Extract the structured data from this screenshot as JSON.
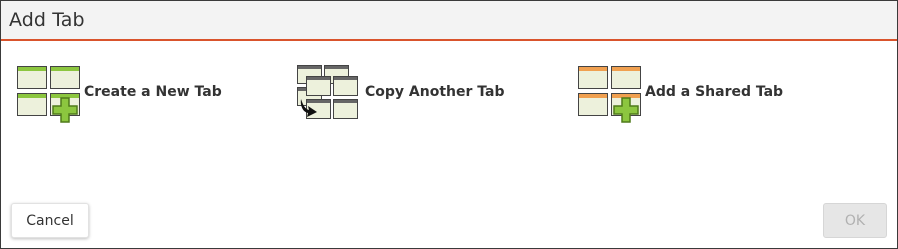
{
  "dialog": {
    "title": "Add Tab"
  },
  "options": [
    {
      "label": "Create a New Tab",
      "icon": "new-tab-icon",
      "accent": "#8cc63f"
    },
    {
      "label": "Copy Another Tab",
      "icon": "copy-tab-icon",
      "accent": "#5a5a5a"
    },
    {
      "label": "Add a Shared Tab",
      "icon": "shared-tab-icon",
      "accent": "#f0a050"
    }
  ],
  "buttons": {
    "cancel_label": "Cancel",
    "ok_label": "OK",
    "ok_disabled": true
  },
  "colors": {
    "header_accent": "#d9532c",
    "plus_green": "#8cc63f",
    "panel_fill": "#ecf0d8"
  }
}
